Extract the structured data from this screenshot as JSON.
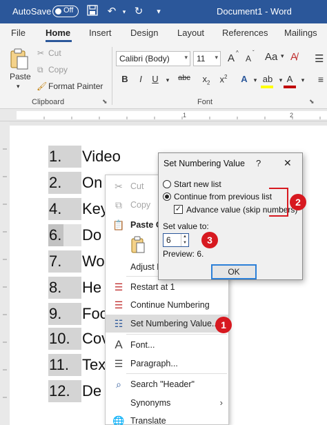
{
  "titlebar": {
    "autosave_label": "AutoSave",
    "autosave_state": "Off",
    "document_title": "Document1  -  Word"
  },
  "tabs": [
    "File",
    "Home",
    "Insert",
    "Design",
    "Layout",
    "References",
    "Mailings"
  ],
  "active_tab": "Home",
  "ribbon": {
    "paste_label": "Paste",
    "cut_label": "Cut",
    "copy_label": "Copy",
    "format_painter_label": "Format Painter",
    "clipboard_group": "Clipboard",
    "font_name": "Calibri (Body)",
    "font_size": "11",
    "font_group": "Font",
    "grow_font": "A",
    "shrink_font": "A",
    "font_color": "A",
    "bold": "B",
    "italic": "I",
    "underline": "U",
    "strikethrough": "abc",
    "subscript": "x",
    "superscript": "x",
    "text_effects": "A",
    "highlight": "ab"
  },
  "ruler": {
    "labels": [
      "1",
      "2"
    ]
  },
  "document": {
    "list_items": [
      {
        "number": "1.",
        "text": "Video"
      },
      {
        "number": "2.",
        "text": "On"
      },
      {
        "number": "4.",
        "text": "Key"
      },
      {
        "number": "6.",
        "text": "Do"
      },
      {
        "number": "7.",
        "text": "Wo"
      },
      {
        "number": "8.",
        "text": "He"
      },
      {
        "number": "9.",
        "text": "Foo"
      },
      {
        "number": "10.",
        "text": "Cov"
      },
      {
        "number": "11.",
        "text": "Tex"
      },
      {
        "number": "12.",
        "text": "De"
      }
    ]
  },
  "context_menu": {
    "cut": "Cut",
    "copy": "Copy",
    "paste_options": "Paste O",
    "adjust_list": "Adjust L",
    "restart_at": "Restart at 1",
    "continue_numbering": "Continue Numbering",
    "set_numbering_value": "Set Numbering Value...",
    "font": "Font...",
    "paragraph": "Paragraph...",
    "search": "Search \"Header\"",
    "synonyms": "Synonyms",
    "translate": "Translate"
  },
  "dialog": {
    "title": "Set Numbering Value",
    "help": "?",
    "close": "✕",
    "start_new_list": "Start new list",
    "continue_previous": "Continue from previous list",
    "advance_value": "Advance value (skip numbers)",
    "set_value_label": "Set value to:",
    "value": "6",
    "preview": "Preview: 6.",
    "ok": "OK",
    "selected_option": "continue_previous",
    "advance_checked": true
  },
  "callouts": [
    "1",
    "2",
    "3"
  ],
  "colors": {
    "title_bar": "#2b579a",
    "callout": "#d71920",
    "font_color_bar": "#c00000",
    "highlight_bar": "#ffff00"
  }
}
